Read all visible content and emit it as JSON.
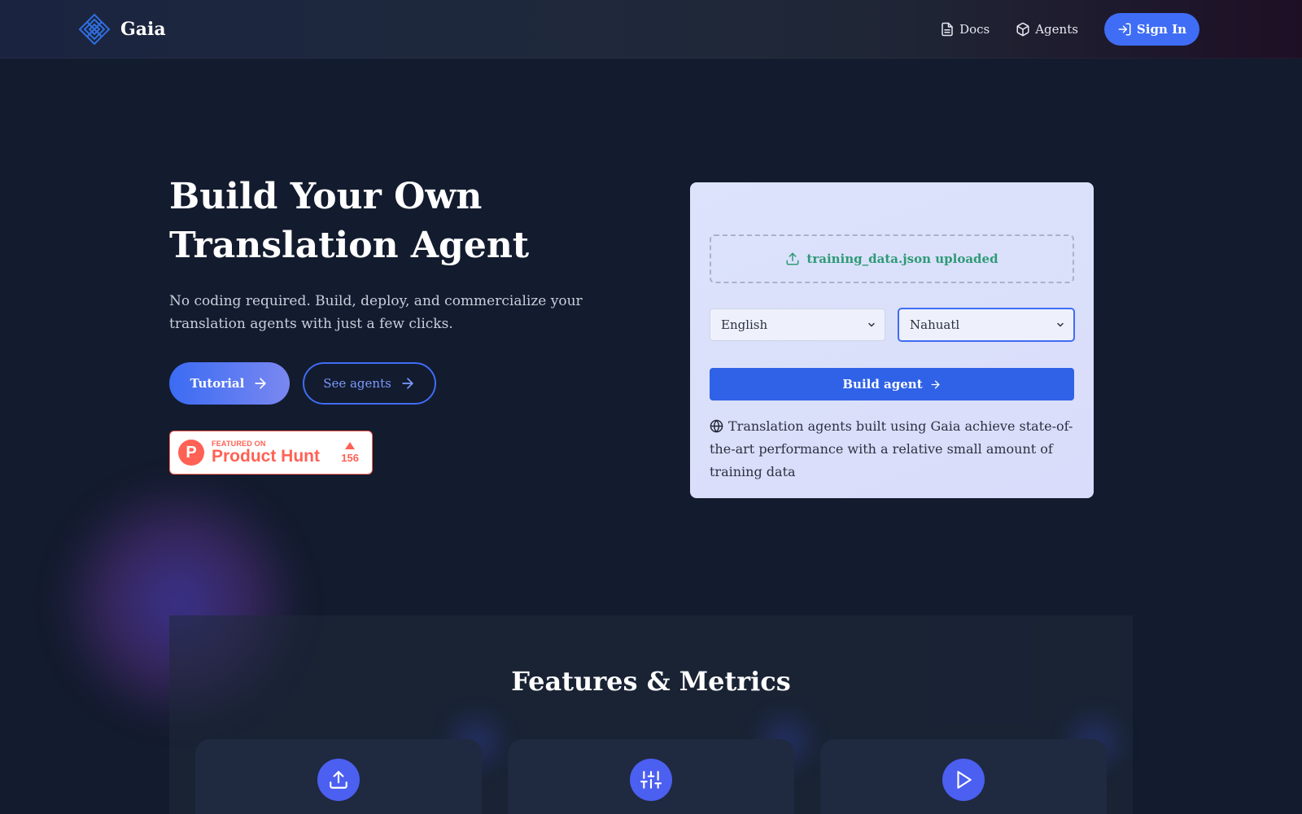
{
  "brand": {
    "name": "Gaia",
    "accent": "#3f6df5"
  },
  "nav": {
    "docs_label": "Docs",
    "agents_label": "Agents",
    "signin_label": "Sign In"
  },
  "hero": {
    "title": "Build Your Own Translation Agent",
    "subtitle": "No coding required. Build, deploy, and commercialize your translation agents with just a few clicks.",
    "tutorial_label": "Tutorial",
    "see_agents_label": "See agents"
  },
  "product_hunt": {
    "featured_label": "FEATURED ON",
    "name": "Product Hunt",
    "votes": "156"
  },
  "builder": {
    "upload_status": "training_data.json uploaded",
    "source_language": "English",
    "target_language": "Nahuatl",
    "build_label": "Build agent",
    "note": "Translation agents built using Gaia achieve state-of-the-art performance with a relative small amount of training data"
  },
  "features": {
    "title": "Features & Metrics",
    "cards": [
      {
        "icon": "upload-icon"
      },
      {
        "icon": "sliders-icon"
      },
      {
        "icon": "play-icon"
      }
    ]
  }
}
